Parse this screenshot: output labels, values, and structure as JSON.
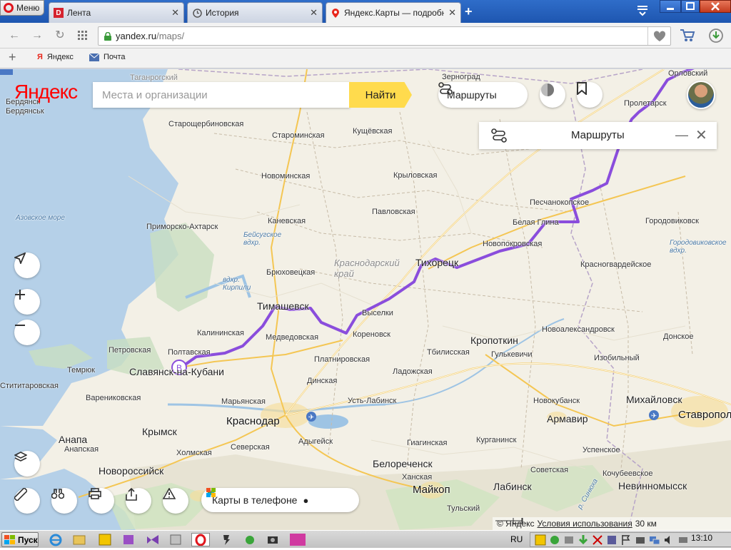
{
  "browser": {
    "menu_label": "Меню",
    "tabs": [
      {
        "label": "Лента",
        "icon": "d-icon"
      },
      {
        "label": "История",
        "icon": "clock-icon"
      },
      {
        "label": "Яндекс.Карты — подробная",
        "icon": "map-pin-icon"
      }
    ],
    "url_host": "yandex.ru",
    "url_path": "/maps/",
    "bookmarks": [
      {
        "label": "Яндекс"
      },
      {
        "label": "Почта"
      }
    ]
  },
  "map": {
    "logo": "Яндекс",
    "search_placeholder": "Места и организации",
    "find_label": "Найти",
    "routes_button": "Маршруты",
    "panel_title": "Маршруты",
    "phone_promo": "Карты в телефоне",
    "copyright": "© Яндекс",
    "terms": "Условия использования",
    "scale": "30 км",
    "route_color": "#8a4ddc",
    "marker_label": "B",
    "labels": {
      "taganrog": "Таганрогский",
      "berdyansk1": "Бердянск",
      "berdyansk2": "Бердянськ",
      "zernograd": "Зерноград",
      "orlovsky": "Орловский",
      "proletarsk": "Пролетарск",
      "starosherb": "Старощербиновская",
      "starominskaya": "Староминская",
      "kushchevskaya": "Кущёвская",
      "novominskaya": "Новоминская",
      "krylovskaya": "Крыловская",
      "azov_sea": "Азовское море",
      "primorsko": "Приморско-Ахтарск",
      "kanevskaya": "Каневская",
      "pavlovskaya": "Павловская",
      "peschanokop": "Песчанокопское",
      "belaya_glina": "Белая Глина",
      "gorodovikovsk": "Городовиковск",
      "beisug": "Бейсугское вдхр.",
      "novopokrovskaya": "Новопокровская",
      "gorodovik_vdhr": "Городовиковское вдхр.",
      "bryukhovetskaya": "Брюховецкая",
      "krasnodar_krai": "Краснодарский край",
      "tikhoretsk": "Тихорецк",
      "krasnogvardeyskoe": "Красногвардейское",
      "kirpili": "вдхр. Кирпили",
      "timashevsk": "Тимашевск",
      "vyselki": "Выселки",
      "kalininskaya": "Калининская",
      "medvedovskaya": "Медведовская",
      "korenovsk": "Кореновск",
      "kropotkin": "Кропоткин",
      "novoaleksandrovsk": "Новоалександровск",
      "donskoe": "Донское",
      "petrovskaya": "Петровская",
      "poltavskaya": "Полтавская",
      "platnirovskaya": "Платнировская",
      "tbilisskaya": "Тбилисская",
      "gulkevichi": "Гулькевичи",
      "izobilny": "Изобильный",
      "temryuk": "Темрюк",
      "slavyansk": "Славянск-на-Кубани",
      "ladozhskaya": "Ладожская",
      "titarovskaya": "Стититаровская",
      "dinskaya": "Динская",
      "novokubansk": "Новокубанск",
      "mikhaylovsk": "Михайловск",
      "varenikovskaya": "Варениковская",
      "maryanskaya": "Марьянская",
      "ust_labinsk": "Усть-Лабинск",
      "stavropol": "Ставрополь",
      "krasnodar": "Краснодар",
      "armavir": "Армавир",
      "anapa": "Анапа",
      "anapskaya": "Анапская",
      "krymsk": "Крымск",
      "adygeysk": "Адыгейск",
      "giaginskaya": "Гиагинская",
      "kurganinsk": "Курганинск",
      "uspenskoe": "Успенское",
      "kholmskaya": "Холмская",
      "severskaya": "Северская",
      "novorossiysk": "Новороссийск",
      "belorechensk": "Белореченск",
      "sovetskaya": "Советская",
      "kochubeevskoe": "Кочубеевское",
      "khanskaya": "Ханская",
      "labinsk": "Лабинск",
      "nevinnomyssk": "Невинномысск",
      "maykop": "Майкоп",
      "tulsky": "Тульский",
      "r_sinyukha": "р. Синюха"
    }
  },
  "taskbar": {
    "start_label": "Пуск",
    "lang": "RU",
    "clock": "13:10"
  }
}
